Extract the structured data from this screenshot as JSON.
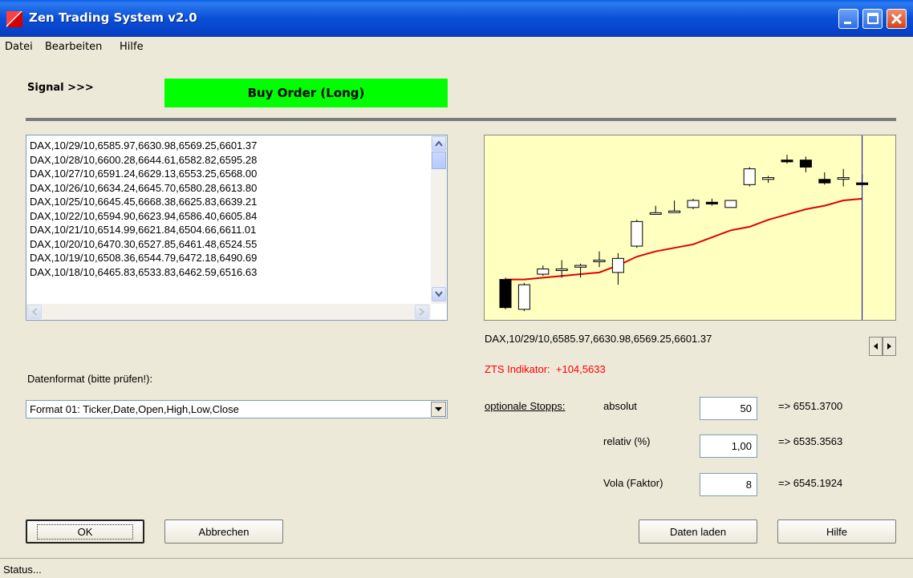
{
  "window": {
    "title": "Zen Trading System v2.0"
  },
  "menu": [
    "Datei",
    "Bearbeiten",
    "Hilfe"
  ],
  "signal": {
    "label": "Signal >>>",
    "value": "Buy Order (Long)",
    "color": "#00ff00"
  },
  "data_list": {
    "lines": [
      "DAX,10/29/10,6585.97,6630.98,6569.25,6601.37",
      "DAX,10/28/10,6600.28,6644.61,6582.82,6595.28",
      "DAX,10/27/10,6591.24,6629.13,6553.25,6568.00",
      "DAX,10/26/10,6634.24,6645.70,6580.28,6613.80",
      "DAX,10/25/10,6645.45,6668.38,6625.83,6639.21",
      "DAX,10/22/10,6594.90,6623.94,6586.40,6605.84",
      "DAX,10/21/10,6514.99,6621.84,6504.66,6611.01",
      "DAX,10/20/10,6470.30,6527.85,6461.48,6524.55",
      "DAX,10/19/10,6508.36,6544.79,6472.18,6490.69",
      "DAX,10/18/10,6465.83,6533.83,6462.59,6516.63"
    ]
  },
  "format": {
    "label": "Datenformat (bitte prüfen!):",
    "selected": "Format 01: Ticker,Date,Open,High,Low,Close"
  },
  "chart_caption": "DAX,10/29/10,6585.97,6630.98,6569.25,6601.37",
  "indicator": {
    "label": "ZTS Indikator:",
    "value": "+104,5633"
  },
  "stops": {
    "label": "optionale Stopps:",
    "rows": [
      {
        "label": "absolut",
        "value": "50",
        "result": "=>  6551.3700"
      },
      {
        "label": "relativ (%)",
        "value": "1,00",
        "result": "=>  6535.3563"
      },
      {
        "label": "Vola (Faktor)",
        "value": "8",
        "result": "=>  6545.1924"
      }
    ]
  },
  "buttons": {
    "ok": "OK",
    "cancel": "Abbrechen",
    "load": "Daten laden",
    "help": "Hilfe"
  },
  "status": "Status...",
  "chart_data": {
    "type": "candlestick",
    "colors": {
      "background": "#ffffc0",
      "indicator_line": "#e00000",
      "cursor_line": "#0000aa"
    },
    "candles": [
      {
        "open": 0.58,
        "high": 0.59,
        "low": 0.41,
        "close": 0.42
      },
      {
        "open": 0.41,
        "high": 0.56,
        "low": 0.4,
        "close": 0.55
      },
      {
        "open": 0.61,
        "high": 0.66,
        "low": 0.6,
        "close": 0.64
      },
      {
        "open": 0.64,
        "high": 0.69,
        "low": 0.59,
        "close": 0.64
      },
      {
        "open": 0.65,
        "high": 0.67,
        "low": 0.59,
        "close": 0.66
      },
      {
        "open": 0.69,
        "high": 0.74,
        "low": 0.65,
        "close": 0.69
      },
      {
        "open": 0.62,
        "high": 0.73,
        "low": 0.55,
        "close": 0.7
      },
      {
        "open": 0.77,
        "high": 0.92,
        "low": 0.76,
        "close": 0.91
      },
      {
        "open": 0.96,
        "high": 1.0,
        "low": 0.95,
        "close": 0.96
      },
      {
        "open": 0.97,
        "high": 1.03,
        "low": 0.96,
        "close": 0.97
      },
      {
        "open": 0.99,
        "high": 1.04,
        "low": 0.98,
        "close": 1.03
      },
      {
        "open": 1.02,
        "high": 1.04,
        "low": 1.0,
        "close": 1.01
      },
      {
        "open": 0.99,
        "high": 1.03,
        "low": 0.99,
        "close": 1.03
      },
      {
        "open": 1.12,
        "high": 1.22,
        "low": 1.11,
        "close": 1.21
      },
      {
        "open": 1.15,
        "high": 1.17,
        "low": 1.13,
        "close": 1.16
      },
      {
        "open": 1.26,
        "high": 1.29,
        "low": 1.24,
        "close": 1.25
      },
      {
        "open": 1.26,
        "high": 1.28,
        "low": 1.19,
        "close": 1.22
      },
      {
        "open": 1.15,
        "high": 1.19,
        "low": 1.12,
        "close": 1.13
      },
      {
        "open": 1.16,
        "high": 1.21,
        "low": 1.11,
        "close": 1.16
      },
      {
        "open": 1.13,
        "high": 1.18,
        "low": 1.11,
        "close": 1.12
      }
    ],
    "indicator": [
      0.58,
      0.58,
      0.59,
      0.6,
      0.61,
      0.62,
      0.66,
      0.71,
      0.74,
      0.76,
      0.78,
      0.82,
      0.86,
      0.88,
      0.92,
      0.95,
      0.98,
      1.0,
      1.03,
      1.04
    ],
    "ylim": [
      0.35,
      1.4
    ]
  }
}
